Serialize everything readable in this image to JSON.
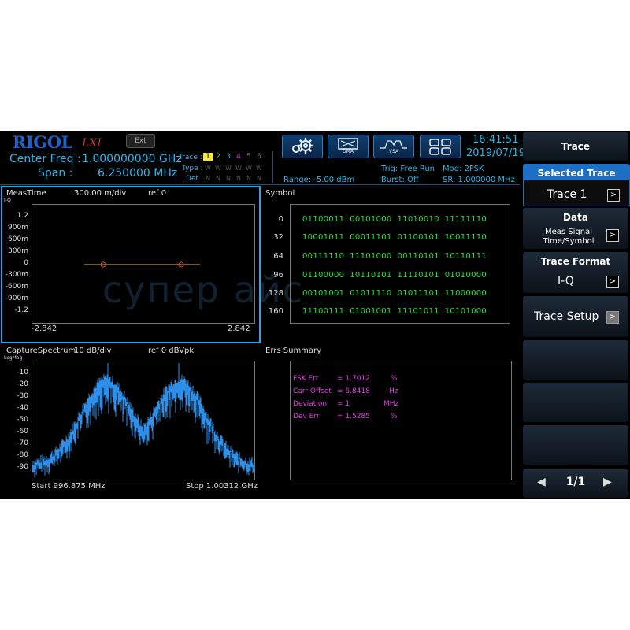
{
  "header": {
    "brand": "RIGOL",
    "brand_sub": "LXI",
    "ext_label": "Ext",
    "center_freq_label": "Center Freq :",
    "center_freq_value": "1.000000000 GHz",
    "span_label": "Span :",
    "span_value": "6.250000 MHz",
    "trace_label": "Trace :",
    "type_label": "Type :",
    "det_label": "Det :",
    "trace_numbers": [
      "1",
      "2",
      "3",
      "4",
      "5",
      "6"
    ],
    "trace_colors": [
      "#f7e63b",
      "#39c24a",
      "#27b3e6",
      "#d43cd6",
      "#7a7a7a",
      "#7a7a7a"
    ],
    "type_values": [
      "W",
      "W",
      "W",
      "W",
      "W",
      "W"
    ],
    "det_values": [
      "N",
      "N",
      "N",
      "N",
      "N",
      "N"
    ],
    "range": "Range: -5.00 dBm",
    "trig": "Trig: Free Run",
    "burst": "Burst: Off",
    "mod": "Mod: 2FSK",
    "sr": "SR: 1.000000 MHz",
    "time": "16:41:51",
    "date": "2019/07/19",
    "mode_buttons": [
      {
        "icon": "settings-icon"
      },
      {
        "icon": "dma-icon",
        "label": "DMA"
      },
      {
        "icon": "vsa-icon",
        "label": "VSA"
      },
      {
        "icon": "grid-icon"
      }
    ]
  },
  "meas_panel": {
    "title": "MeasTime",
    "scale": "300.00 m/div",
    "ref": "ref 0",
    "subtitle": "I-Q",
    "yticks": [
      "1.2",
      "900m",
      "600m",
      "300m",
      "0",
      "-300m",
      "-600m",
      "-900m",
      "-1.2"
    ],
    "x_left": "-2.842",
    "x_right": "2.842"
  },
  "symbol_panel": {
    "title": "Symbol",
    "rows": [
      {
        "index": "0",
        "bits": "01100011  00101000  11010010  11111110"
      },
      {
        "index": "32",
        "bits": "10001011  00011101  01100101  10011110"
      },
      {
        "index": "64",
        "bits": "00111110  11101000  00110101  10110111"
      },
      {
        "index": "96",
        "bits": "01100000  10110101  11110101  01010000"
      },
      {
        "index": "128",
        "bits": "00101001  01011110  01011101  11000000"
      },
      {
        "index": "160",
        "bits": "11100111  01001001  11101011  10101000"
      }
    ]
  },
  "spectrum_panel": {
    "title": "CaptureSpectrum",
    "scale": "10 dB/div",
    "ref": "ref 0 dBVpk",
    "subtitle": "LogMag",
    "yticks": [
      "-10",
      "-20",
      "-30",
      "-40",
      "-50",
      "-60",
      "-70",
      "-80",
      "-90"
    ],
    "start": "Start 996.875 MHz",
    "stop": "Stop 1.00312 GHz",
    "trace_color": "#2f8fe8"
  },
  "errs_panel": {
    "title": "Errs Summary",
    "items": [
      {
        "label": "FSK Err",
        "value": "= 1.7012",
        "unit": "%"
      },
      {
        "label": "Carr Offset",
        "value": "= 6.8418",
        "unit": "Hz"
      },
      {
        "label": "Deviation",
        "value": "= 1",
        "unit": "MHz"
      },
      {
        "label": "Dev Err",
        "value": "= 1.5285",
        "unit": "%"
      }
    ]
  },
  "softkeys": {
    "menu_title": "Trace",
    "selected_trace_title": "Selected Trace",
    "selected_trace_value": "Trace 1",
    "data_title": "Data",
    "data_value_line1": "Meas Signal",
    "data_value_line2": "Time/Symbol",
    "trace_format_title": "Trace Format",
    "trace_format_value": "I-Q",
    "trace_setup": "Trace Setup",
    "page": "1/1"
  },
  "watermark": "супер айс",
  "colors": {
    "accent": "#25b7e8",
    "symbol_bits": "#27e037",
    "errs": "#e23ee8",
    "active_border": "#2aa3e8"
  }
}
